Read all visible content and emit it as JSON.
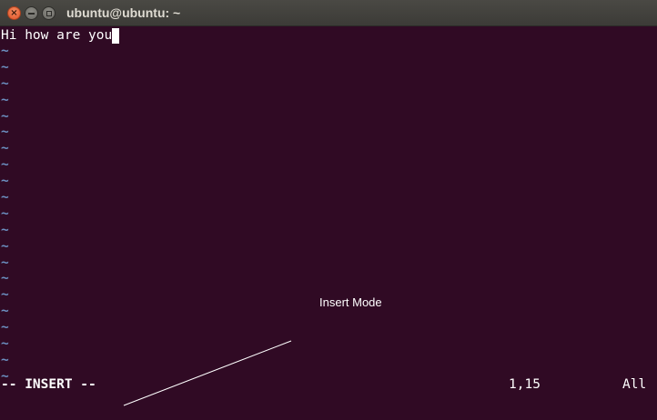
{
  "window": {
    "title": "ubuntu@ubuntu: ~",
    "buttons": {
      "close": "×",
      "minimize": "minimize",
      "maximize": "maximize"
    }
  },
  "editor": {
    "buffer_line_1": "Hi how are you",
    "empty_line_marker": "~",
    "empty_line_count": 21
  },
  "statusline": {
    "mode": "-- INSERT --",
    "cursor_position": "1,15",
    "scroll": "All"
  },
  "annotation": {
    "label": "Insert Mode"
  },
  "colors": {
    "background": "#300a24",
    "titlebar": "#3c3b37",
    "tilde": "#6b8fc0",
    "text": "#ffffff",
    "close_button": "#e0542a"
  }
}
